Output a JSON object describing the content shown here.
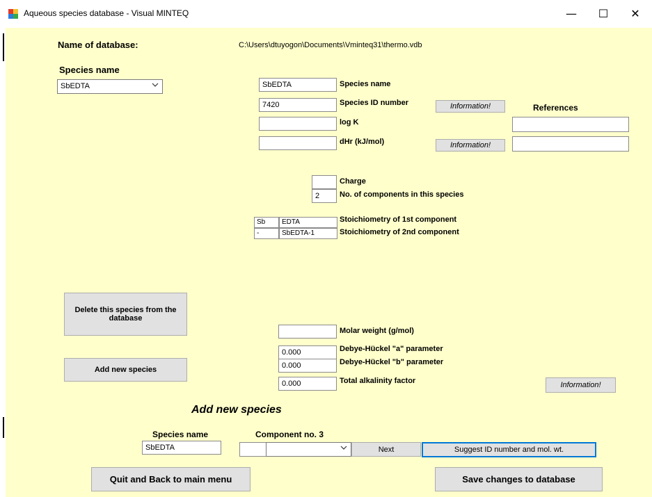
{
  "window": {
    "title": "Aqueous species database - Visual MINTEQ",
    "minimize": "—",
    "maximize": "☐",
    "close": "✕"
  },
  "header": {
    "db_label": "Name of database:",
    "db_path": "C:\\Users\\dtuyogon\\Documents\\Vminteq31\\thermo.vdb",
    "species_label": "Species name",
    "species_selected": "SbEDTA"
  },
  "form": {
    "species_name_value": "SbEDTA",
    "species_name_label": "Species name",
    "species_id_value": "7420",
    "species_id_label": "Species ID number",
    "logk_value": "",
    "logk_label": "log K",
    "dhr_value": "",
    "dhr_label": "dHr (kJ/mol)",
    "info_button": "Information!",
    "references_label": "References",
    "ref1": "",
    "ref2": "",
    "charge_value": "",
    "charge_label": "Charge",
    "ncomp_value": "2",
    "ncomp_label": "No. of components in this species",
    "stoich": [
      {
        "coef": "Sb",
        "comp": "EDTA",
        "label": "Stoichiometry of 1st component"
      },
      {
        "coef": "-",
        "comp": "SbEDTA-1",
        "label": "Stoichiometry of 2nd component"
      }
    ],
    "molar_weight_value": "",
    "molar_weight_label": "Molar weight (g/mol)",
    "dh_a_value": "0.000",
    "dh_a_label": "Debye-Hückel \"a\" parameter",
    "dh_b_value": "0.000",
    "dh_b_label": "Debye-Hückel \"b\" parameter",
    "alk_value": "0.000",
    "alk_label": "Total alkalinity factor"
  },
  "actions": {
    "delete": "Delete this species from the database",
    "add_new": "Add new species",
    "quit": "Quit and Back to main menu",
    "save": "Save changes to database"
  },
  "add_section": {
    "heading": "Add new species",
    "species_name_label": "Species name",
    "species_name_value": "SbEDTA",
    "component_label": "Component no. 3",
    "coef_value": "",
    "component_selected": "",
    "next": "Next",
    "suggest": "Suggest ID number and mol. wt."
  }
}
